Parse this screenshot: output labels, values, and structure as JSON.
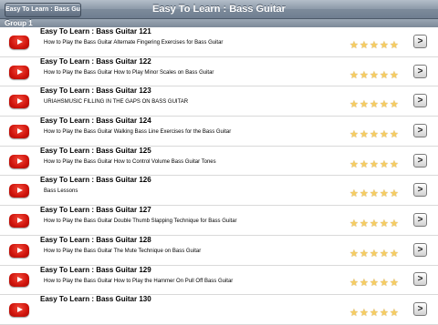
{
  "navbar": {
    "back_label": "Easy To Learn : Bass Guitar",
    "title": "Easy To Learn : Bass Guitar"
  },
  "group": {
    "label": "Group 1"
  },
  "rating_stars": 5,
  "arrow_glyph": ">",
  "items": [
    {
      "title": "Easy To Learn : Bass Guitar 121",
      "subtitle": "How to Play the Bass Guitar  Alternate Fingering Exercises for Bass Guitar"
    },
    {
      "title": "Easy To Learn : Bass Guitar 122",
      "subtitle": "How to Play the Bass Guitar  How to Play Minor Scales on Bass Guitar"
    },
    {
      "title": "Easy To Learn : Bass Guitar 123",
      "subtitle": "URIAHSMUSIC FILLING IN THE GAPS ON BASS GUITAR"
    },
    {
      "title": "Easy To Learn : Bass Guitar 124",
      "subtitle": "How to Play the Bass Guitar  Walking Bass Line Exercises for the Bass Guitar"
    },
    {
      "title": "Easy To Learn : Bass Guitar 125",
      "subtitle": "How to Play the Bass Guitar  How to Control Volume  Bass Guitar Tones"
    },
    {
      "title": "Easy To Learn : Bass Guitar 126",
      "subtitle": "Bass Lessons"
    },
    {
      "title": "Easy To Learn : Bass Guitar 127",
      "subtitle": "How to Play the Bass Guitar  Double Thumb Slapping Technique for Bass Guitar"
    },
    {
      "title": "Easy To Learn : Bass Guitar 128",
      "subtitle": "How to Play the Bass Guitar  The Mute Technique on Bass Guitar"
    },
    {
      "title": "Easy To Learn : Bass Guitar 129",
      "subtitle": "How to Play the Bass Guitar  How to Play the Hammer On Pull Off Bass Guitar"
    },
    {
      "title": "Easy To Learn : Bass Guitar 130",
      "subtitle": ""
    }
  ]
}
